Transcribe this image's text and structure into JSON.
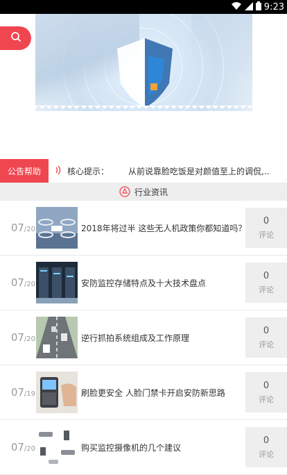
{
  "status_bar": {
    "time": "9:23"
  },
  "notice": {
    "tag": "公告帮助",
    "label": "核心提示：",
    "text": "从前说靠脸吃饭是对颜值至上的调侃,..."
  },
  "section": {
    "title": "行业资讯"
  },
  "articles": [
    {
      "date_main": "07",
      "date_sub": "/20",
      "title": "2018年将过半 这些无人机政策你都知道吗？",
      "comment_count": "0",
      "comment_label": "评论",
      "thumb_icon": "drone-image"
    },
    {
      "date_main": "07",
      "date_sub": "/20",
      "title": "安防监控存储特点及十大技术盘点",
      "comment_count": "0",
      "comment_label": "评论",
      "thumb_icon": "server-room-image"
    },
    {
      "date_main": "07",
      "date_sub": "/20",
      "title": "逆行抓拍系统组成及工作原理",
      "comment_count": "0",
      "comment_label": "评论",
      "thumb_icon": "road-traffic-image"
    },
    {
      "date_main": "07",
      "date_sub": "/19",
      "title": "刷脸更安全 人脸门禁卡开启安防新思路",
      "comment_count": "0",
      "comment_label": "评论",
      "thumb_icon": "face-access-image"
    },
    {
      "date_main": "07",
      "date_sub": "/20",
      "title": "购买监控摄像机的几个建议",
      "comment_count": "0",
      "comment_label": "评论",
      "thumb_icon": "cctv-cameras-image"
    }
  ],
  "colors": {
    "accent": "#f04650",
    "section_bg": "#eeeeee"
  }
}
